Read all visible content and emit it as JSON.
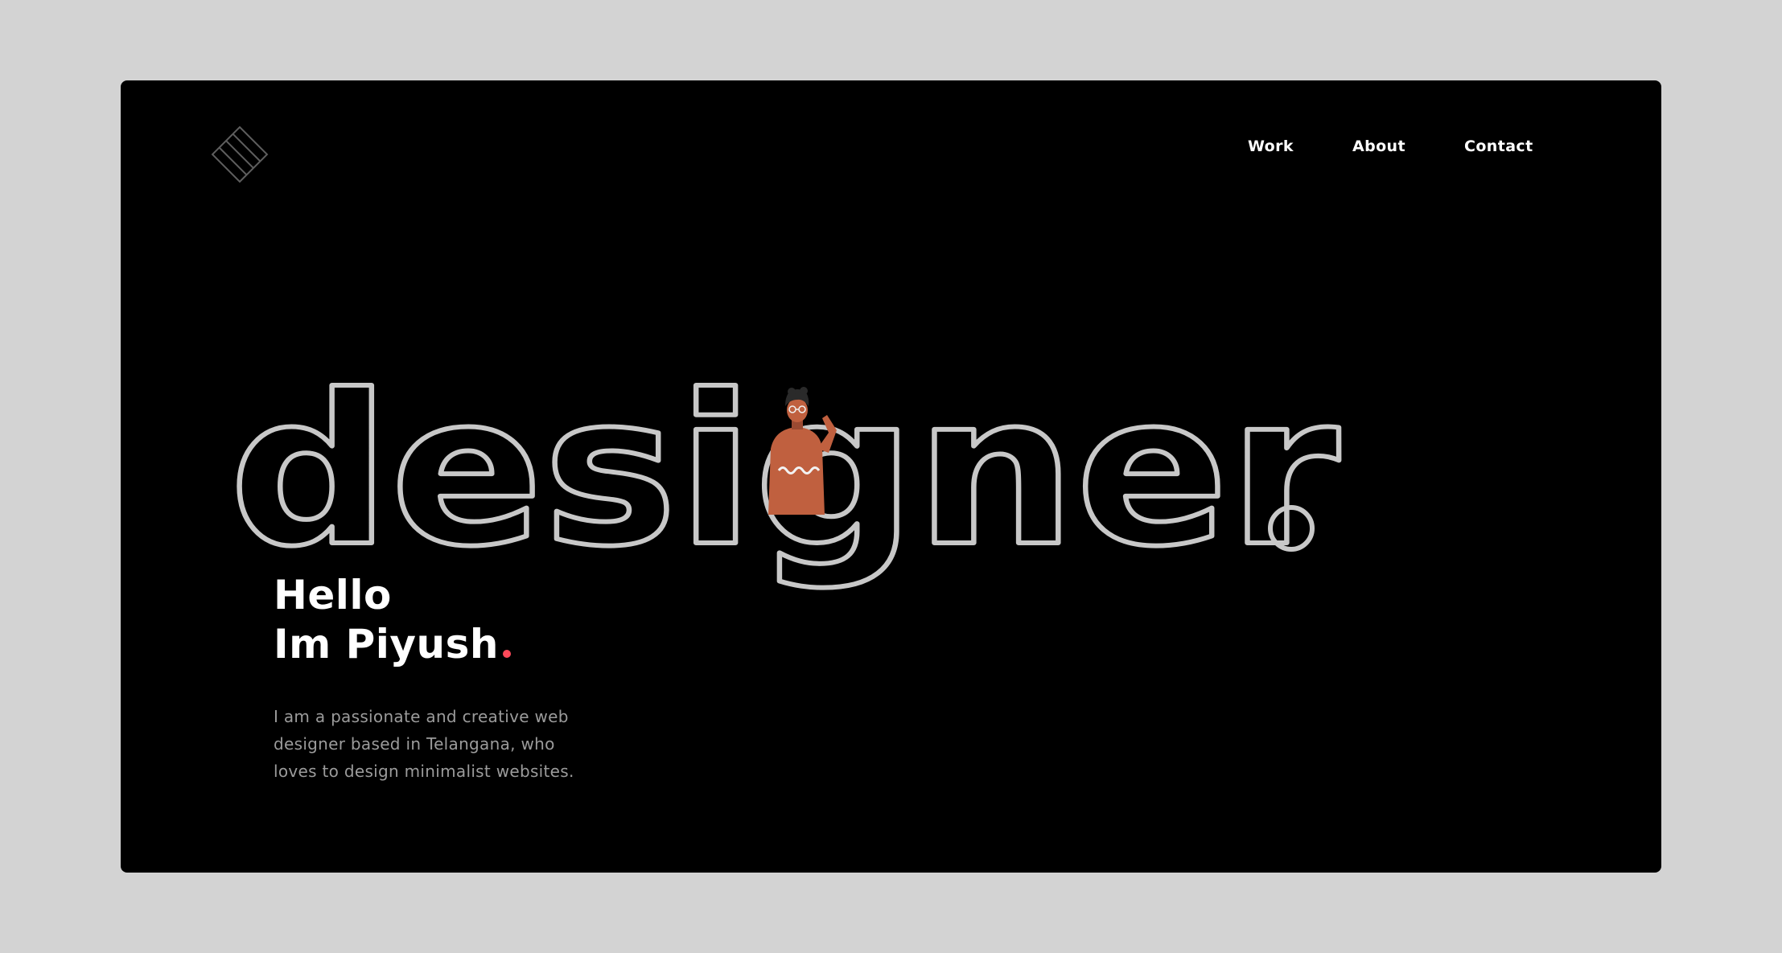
{
  "nav": {
    "items": [
      {
        "label": "Work"
      },
      {
        "label": "About"
      },
      {
        "label": "Contact"
      }
    ]
  },
  "hero": {
    "word": "designer",
    "period": "."
  },
  "intro": {
    "greeting_line1": "Hello",
    "greeting_line2": "Im Piyush",
    "bio": "I am a passionate and creative web designer based in Telangana, who loves to design minimalist websites."
  },
  "colors": {
    "page_background": "#d3d3d3",
    "frame_background": "#000000",
    "outline_text": "#c8c8c8",
    "accent_dot": "#ff4a5a",
    "avatar_sweater": "#c0603f"
  },
  "icons": {
    "logo": "striped-diamond-logo",
    "avatar": "waving-person-avatar"
  }
}
